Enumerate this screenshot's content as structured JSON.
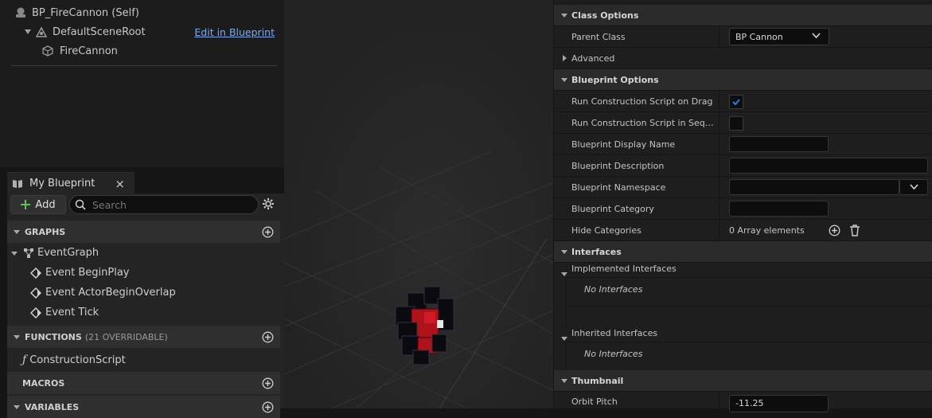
{
  "components": {
    "root_label": "BP_FireCannon (Self)",
    "scene_root_label": "DefaultSceneRoot",
    "edit_link": "Edit in Blueprint",
    "child_label": "FireCannon"
  },
  "my_blueprint": {
    "tab_label": "My Blueprint",
    "close_glyph": "×",
    "add_label": "Add",
    "search_placeholder": "Search",
    "graphs_header": "GRAPHS",
    "graph_name": "EventGraph",
    "events": [
      "Event BeginPlay",
      "Event ActorBeginOverlap",
      "Event Tick"
    ],
    "functions_header": "FUNCTIONS",
    "functions_sub": "(21 OVERRIDABLE)",
    "function_name": "ConstructionScript",
    "macros_header": "MACROS",
    "variables_header": "VARIABLES"
  },
  "details": {
    "class_options": "Class Options",
    "parent_class_label": "Parent Class",
    "parent_class_value": "BP Cannon",
    "advanced": "Advanced",
    "blueprint_options": "Blueprint Options",
    "run_cs_drag": "Run Construction Script on Drag",
    "run_cs_drag_checked": true,
    "run_cs_seq": "Run Construction Script in Sequencer",
    "run_cs_seq_checked": false,
    "display_name": "Blueprint Display Name",
    "description": "Blueprint Description",
    "namespace": "Blueprint Namespace",
    "category": "Blueprint Category",
    "hide_categories": "Hide Categories",
    "hide_categories_value": "0 Array elements",
    "interfaces": "Interfaces",
    "implemented": "Implemented Interfaces",
    "no_interfaces_1": "No Interfaces",
    "inherited": "Inherited Interfaces",
    "no_interfaces_2": "No Interfaces",
    "thumbnail": "Thumbnail",
    "orbit_pitch": "Orbit Pitch",
    "orbit_pitch_value": "-11.25"
  },
  "colors": {
    "accent_green": "#5fc25a",
    "link_blue": "#7fa9e8",
    "check_blue": "#2f7fe0",
    "mesh_red": "#b0121b"
  }
}
